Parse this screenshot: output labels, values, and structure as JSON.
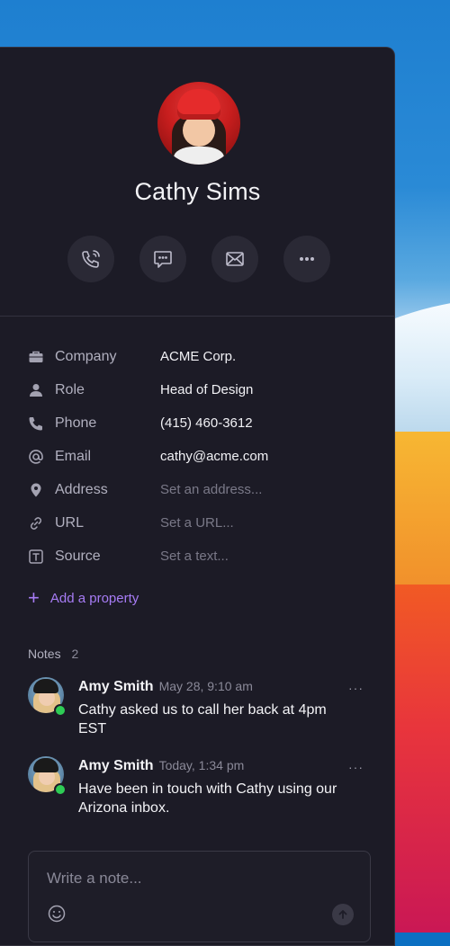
{
  "contact": {
    "name": "Cathy Sims"
  },
  "actions": [
    {
      "name": "call",
      "icon": "phone-icon"
    },
    {
      "name": "message",
      "icon": "chat-icon"
    },
    {
      "name": "email",
      "icon": "mail-icon"
    },
    {
      "name": "more",
      "icon": "more-icon"
    }
  ],
  "properties": [
    {
      "label": "Company",
      "value": "ACME Corp.",
      "icon": "briefcase-icon",
      "placeholder": false
    },
    {
      "label": "Role",
      "value": "Head of Design",
      "icon": "person-icon",
      "placeholder": false
    },
    {
      "label": "Phone",
      "value": "(415) 460-3612",
      "icon": "phone-icon",
      "placeholder": false
    },
    {
      "label": "Email",
      "value": "cathy@acme.com",
      "icon": "at-icon",
      "placeholder": false
    },
    {
      "label": "Address",
      "value": "Set an address...",
      "icon": "location-pin-icon",
      "placeholder": true
    },
    {
      "label": "URL",
      "value": "Set a URL...",
      "icon": "link-icon",
      "placeholder": true
    },
    {
      "label": "Source",
      "value": "Set a text...",
      "icon": "text-box-icon",
      "placeholder": true
    }
  ],
  "add_property_label": "Add a property",
  "notes": {
    "label": "Notes",
    "count": "2",
    "items": [
      {
        "author": "Amy Smith",
        "time": "May 28, 9:10 am",
        "text": "Cathy asked us to call her back at 4pm EST"
      },
      {
        "author": "Amy Smith",
        "time": "Today, 1:34 pm",
        "text": "Have been in touch with Cathy using our Arizona inbox."
      }
    ],
    "more_label": "···"
  },
  "composer": {
    "placeholder": "Write a note..."
  },
  "colors": {
    "panel": "#1c1b26",
    "accent": "#a77cf5",
    "online": "#2ecc55"
  }
}
